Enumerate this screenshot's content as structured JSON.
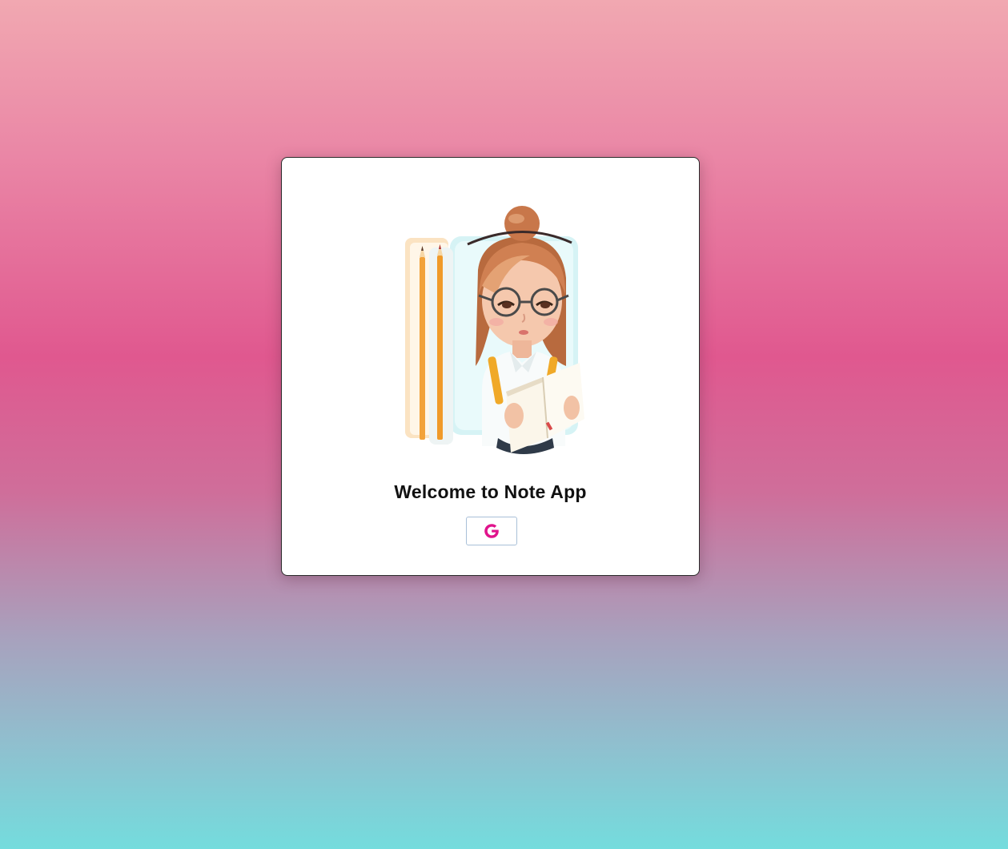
{
  "login_card": {
    "title": "Welcome to Note App",
    "illustration": "girl-reading-notebook-illustration",
    "google_button": {
      "icon": "google-icon",
      "icon_color": "#e0138c"
    }
  },
  "colors": {
    "background_top": "#f1a8b1",
    "background_middle": "#e0588f",
    "background_bottom": "#74dcdd",
    "card_background": "#ffffff",
    "button_border": "#a9c0d8"
  }
}
